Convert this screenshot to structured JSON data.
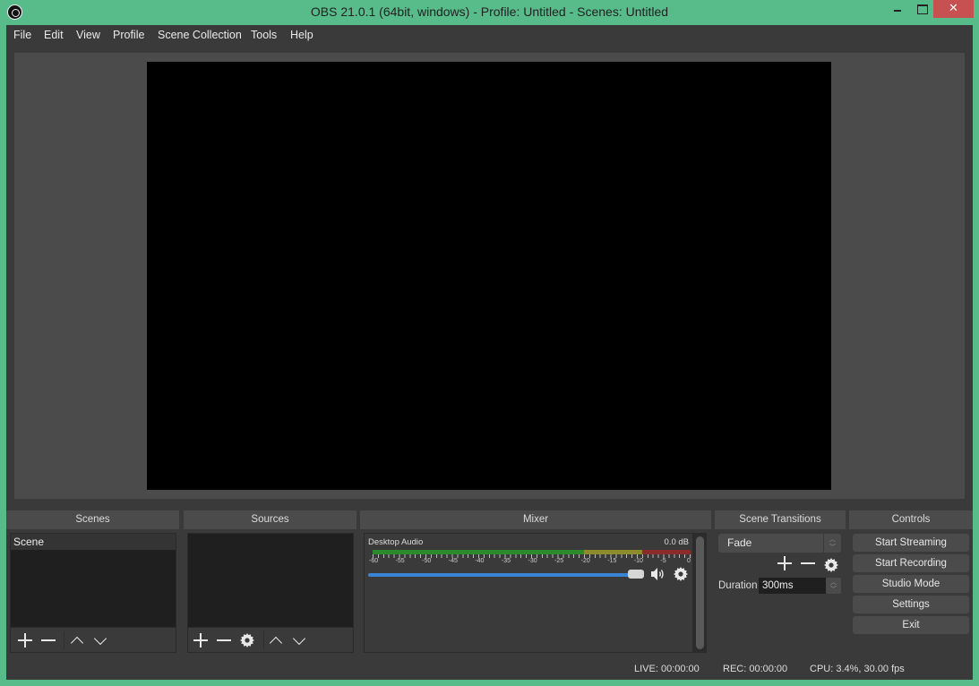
{
  "window": {
    "title": "OBS 21.0.1 (64bit, windows) - Profile: Untitled - Scenes: Untitled",
    "close_glyph": "✕"
  },
  "menu": [
    "File",
    "Edit",
    "View",
    "Profile",
    "Scene Collection",
    "Tools",
    "Help"
  ],
  "docks": {
    "scenes": {
      "title": "Scenes",
      "items": [
        "Scene"
      ]
    },
    "sources": {
      "title": "Sources",
      "items": []
    },
    "mixer": {
      "title": "Mixer",
      "channels": [
        {
          "name": "Desktop Audio",
          "level": "0.0 dB",
          "volume_fraction": 1.0,
          "ticks": [
            "-60",
            "-55",
            "-50",
            "-45",
            "-40",
            "-35",
            "-30",
            "-25",
            "-20",
            "-15",
            "-10",
            "-5",
            "0"
          ]
        }
      ]
    },
    "transitions": {
      "title": "Scene Transitions",
      "selected": "Fade",
      "duration_label": "Duration",
      "duration_value": "300ms"
    },
    "controls": {
      "title": "Controls",
      "buttons": [
        "Start Streaming",
        "Start Recording",
        "Studio Mode",
        "Settings",
        "Exit"
      ]
    }
  },
  "status": {
    "live": "LIVE: 00:00:00",
    "rec": "REC: 00:00:00",
    "cpu": "CPU: 3.4%, 30.00 fps"
  },
  "colors": {
    "accent_window": "#57bb8a",
    "close": "#c75050",
    "meter_green": "#2b8a2b",
    "meter_yellow": "#8c8c2b",
    "meter_red": "#8c2b2b",
    "volume": "#3a84d6"
  }
}
